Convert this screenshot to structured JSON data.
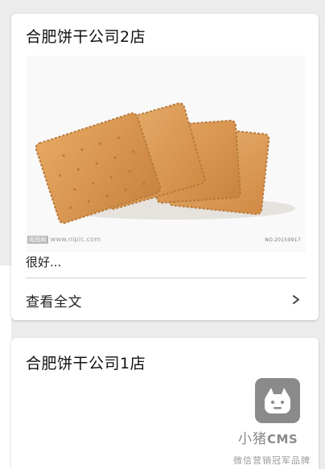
{
  "posts": [
    {
      "title": "合肥饼干公司2店",
      "image_alt": "biscuits",
      "watermark_left_tag": "昵图网",
      "watermark_left_url": "www.nipic.com",
      "watermark_right": "NO.20150917",
      "excerpt": "很好...",
      "read_more": "查看全文",
      "read_more_icon": "chevron-right-icon"
    },
    {
      "title": "合肥饼干公司1店"
    }
  ],
  "brand": {
    "name_cn": "小猪",
    "name_latin": "CMS",
    "tagline": "微信营销冠军品牌",
    "logo_icon": "pig-logo-icon",
    "logo_color": "#8a8a8a"
  }
}
